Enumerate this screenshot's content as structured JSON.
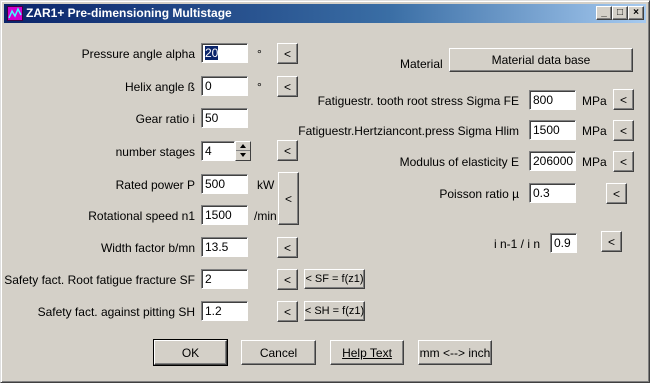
{
  "window": {
    "title": "ZAR1+ Pre-dimensioning Multistage",
    "minimize": "_",
    "maximize": "□",
    "close": "×"
  },
  "left": {
    "pressure_angle": {
      "label": "Pressure angle alpha",
      "value": "20",
      "unit": "°",
      "btn": "<"
    },
    "helix_angle": {
      "label": "Helix angle ß",
      "value": "0",
      "unit": "°",
      "btn": "<"
    },
    "gear_ratio": {
      "label": "Gear ratio i",
      "value": "50"
    },
    "number_stages": {
      "label": "number stages",
      "value": "4",
      "btn": "<"
    },
    "rated_power": {
      "label": "Rated power P",
      "value": "500",
      "unit": "kW"
    },
    "rotational_speed": {
      "label": "Rotational speed n1",
      "value": "1500",
      "unit": "/min"
    },
    "power_speed_btn": "<",
    "width_factor": {
      "label": "Width factor b/mn",
      "value": "13.5",
      "btn": "<"
    },
    "safety_sf": {
      "label": "Safety fact. Root fatigue fracture SF",
      "value": "2",
      "btn": "<",
      "func_btn": "< SF = f(z1)"
    },
    "safety_sh": {
      "label": "Safety fact. against pitting SH",
      "value": "1.2",
      "btn": "<",
      "func_btn": "< SH = f(z1)"
    }
  },
  "right": {
    "material_label": "Material",
    "material_db_btn": "Material data base",
    "sigma_fe": {
      "label": "Fatiguestr. tooth root stress Sigma FE",
      "value": "800",
      "unit": "MPa",
      "btn": "<"
    },
    "sigma_hlim": {
      "label": "Fatiguestr.Hertziancont.press Sigma Hlim",
      "value": "1500",
      "unit": "MPa",
      "btn": "<"
    },
    "modulus_e": {
      "label": "Modulus of elasticity E",
      "value": "206000",
      "unit": "MPa",
      "btn": "<"
    },
    "poisson": {
      "label": "Poisson ratio µ",
      "value": "0.3",
      "btn": "<"
    },
    "ratio_in": {
      "label": "i n-1 / i n",
      "value": "0.9",
      "btn": "<"
    }
  },
  "footer": {
    "ok": "OK",
    "cancel": "Cancel",
    "help": "Help Text",
    "units": "mm <--> inch"
  }
}
